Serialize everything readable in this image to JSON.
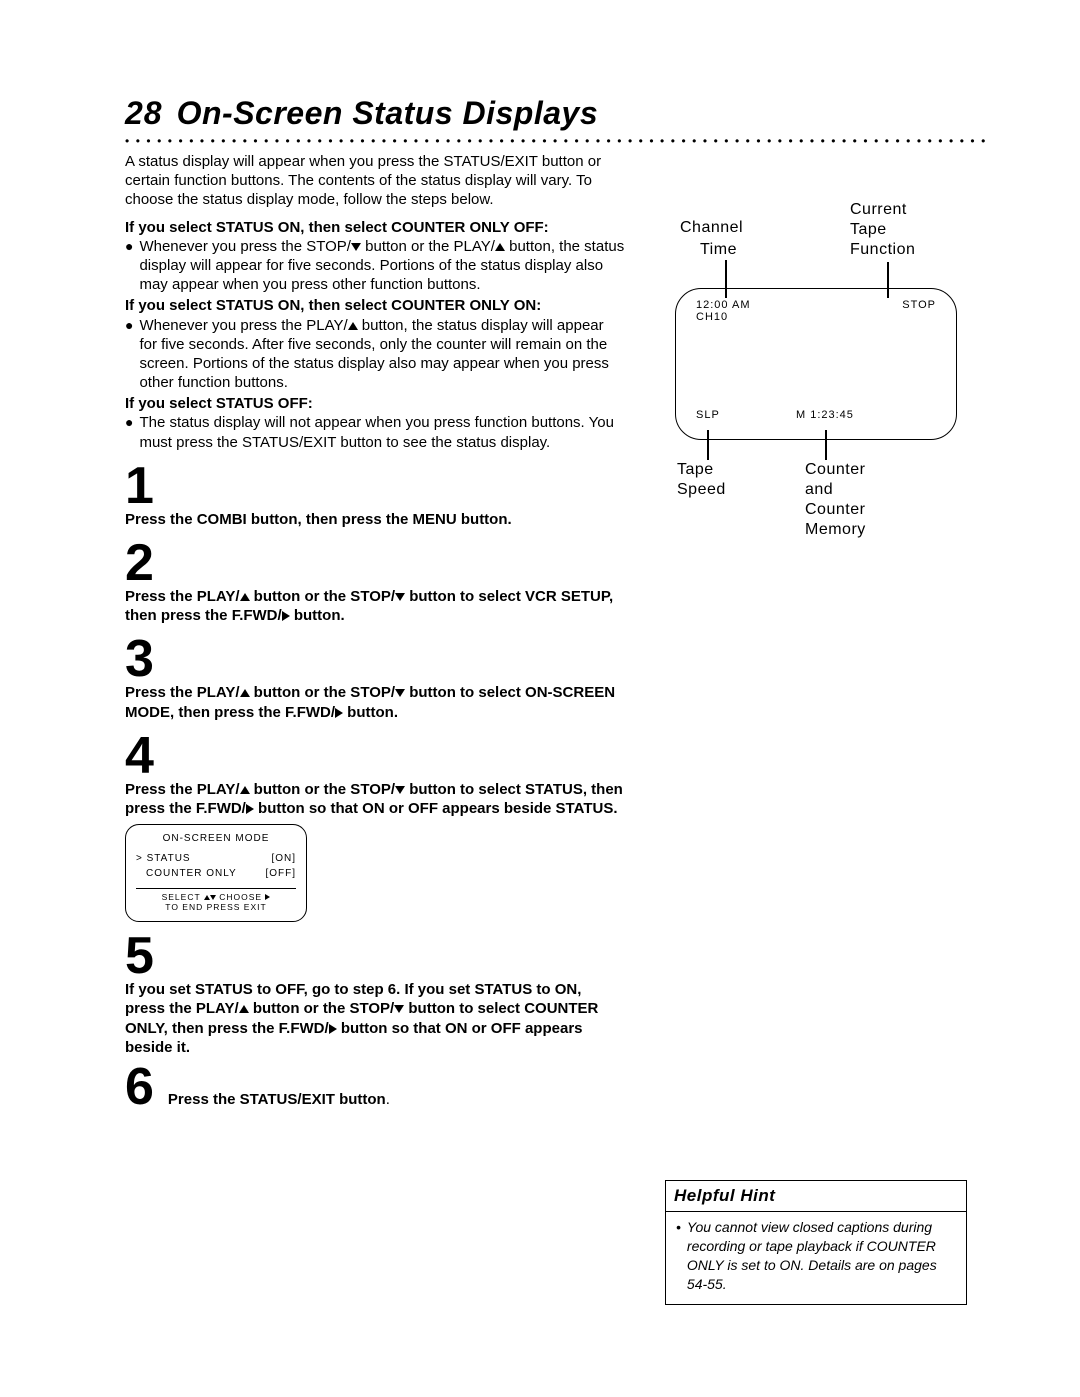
{
  "page": {
    "number": "28",
    "title": "On-Screen Status Displays"
  },
  "intro": "A status display will appear when you press the STATUS/EXIT button or certain function buttons. The contents of the status display will vary. To choose the status display mode, follow the steps below.",
  "sections": [
    {
      "heading": "If you select STATUS ON, then select COUNTER ONLY OFF:",
      "body_a": "Whenever you press the STOP/",
      "body_b": " button or the PLAY/",
      "body_c": " button, the status display will appear for five seconds. Portions of the status display also may appear when you press other function buttons."
    },
    {
      "heading": "If you select STATUS ON, then select COUNTER ONLY ON:",
      "body_a": "Whenever you press the PLAY/",
      "body_b": " button, the status display will appear for five seconds. After five seconds, only the counter will remain on the screen. Portions of the status display also may appear when you press other function buttons."
    },
    {
      "heading": "If you select STATUS OFF:",
      "body": "The status display will not appear when you press function buttons. You must press the STATUS/EXIT button to see the status display."
    }
  ],
  "steps": {
    "s1": {
      "num": "1",
      "text": "Press the COMBI button, then press the MENU button."
    },
    "s2": {
      "num": "2",
      "a": "Press the PLAY/",
      "b": " button or the STOP/",
      "c": " button to select VCR SETUP, then press the F.FWD/",
      "d": " button."
    },
    "s3": {
      "num": "3",
      "a": "Press the PLAY/",
      "b": " button or the STOP/",
      "c": " button to select ON-SCREEN MODE, then press the F.FWD/",
      "d": " button."
    },
    "s4": {
      "num": "4",
      "a": "Press the PLAY/",
      "b": " button or the STOP/",
      "c": " button to select STATUS, then press the F.FWD/",
      "d": " button so that ON or OFF appears beside STATUS."
    },
    "s5": {
      "num": "5",
      "a": "If you set STATUS to OFF, go to step 6. If you set STATUS to ON, press the PLAY/",
      "b": " button or the STOP/",
      "c": " button to select COUNTER ONLY, then press the F.FWD/",
      "d": " button so that ON or OFF appears beside it."
    },
    "s6": {
      "num": "6",
      "text_a": "Press the STATUS/EXIT button",
      "text_b": "."
    }
  },
  "panel": {
    "title": "ON-SCREEN MODE",
    "row1_label": "STATUS",
    "row1_value": "[ON]",
    "row2_label": "COUNTER ONLY",
    "row2_value": "[OFF]",
    "hint1_a": "SELECT ",
    "hint1_b": " CHOOSE ",
    "hint2": "TO  END  PRESS  EXIT"
  },
  "diagram": {
    "labels": {
      "channel": "Channel",
      "time": "Time",
      "current_tape_function": "Current\nTape\nFunction",
      "tape_speed": "Tape\nSpeed",
      "counter": "Counter\nand\nCounter\nMemory"
    },
    "tv": {
      "time": "12:00 AM",
      "channel": "CH10",
      "func": "STOP",
      "speed": "SLP",
      "counter": "M  1:23:45"
    }
  },
  "hint": {
    "title": "Helpful Hint",
    "body": "You cannot view closed captions during recording or tape playback if COUNTER ONLY is set to ON. Details are on pages 54-55."
  },
  "glyphs": {
    "bullet": "●",
    "marker": ">"
  }
}
